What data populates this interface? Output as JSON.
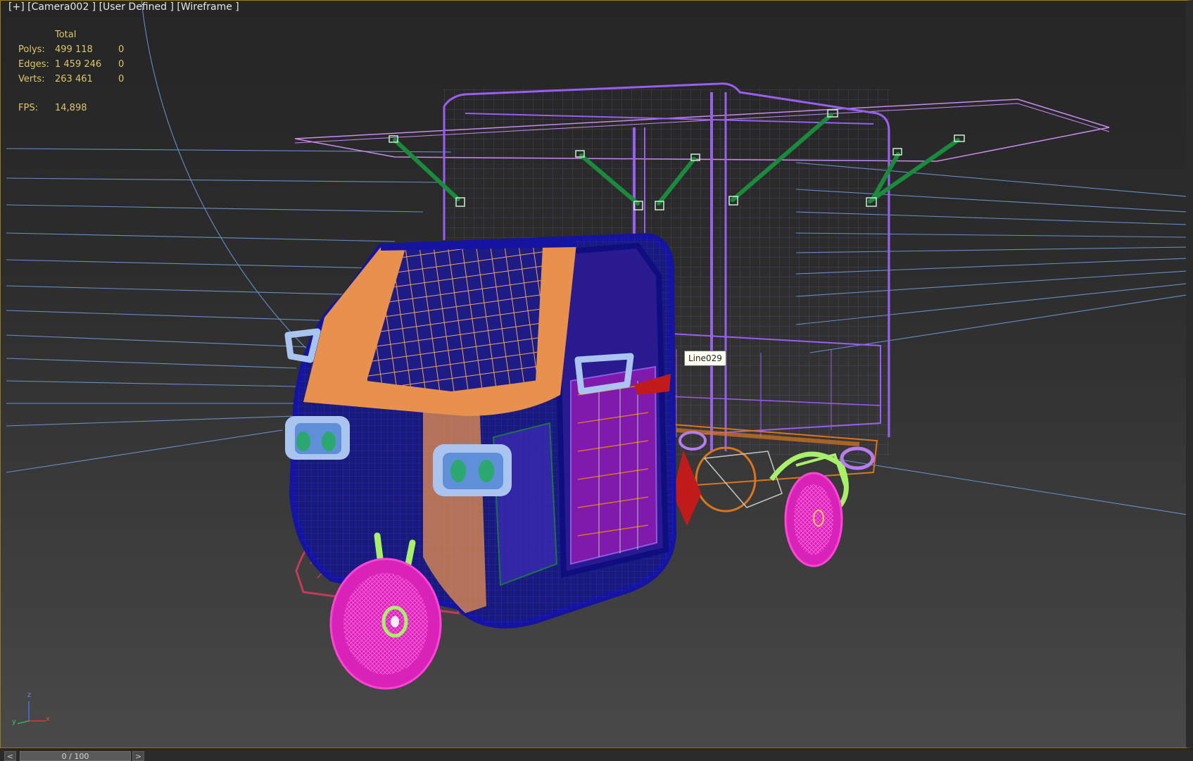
{
  "viewport": {
    "label": "[+] [Camera002 ] [User Defined ] [Wireframe ]",
    "background_top": "#252525",
    "background_bottom": "#494949",
    "border_color": "#9c7a1e"
  },
  "stats": {
    "column_header": "Total",
    "rows": [
      {
        "label": "Polys:",
        "total": "499 118",
        "selected": "0"
      },
      {
        "label": "Edges:",
        "total": "1 459 246",
        "selected": "0"
      },
      {
        "label": "Verts:",
        "total": "263 461",
        "selected": "0"
      }
    ],
    "fps_label": "FPS:",
    "fps_value": "14,898",
    "text_color": "#dcc76b"
  },
  "tooltip": {
    "text": "Line029"
  },
  "axis_gizmo": {
    "z": "z",
    "x": "x",
    "y": "y"
  },
  "timeline": {
    "prev_icon": "chevron-left-icon",
    "prev_glyph": "<",
    "next_icon": "chevron-right-icon",
    "next_glyph": ">",
    "frame_display": "0 / 100"
  },
  "wire_colors": {
    "cabin": "#1414a0",
    "hood": "#e8914f",
    "canopy": "#9a5ef0",
    "struts": "#1a8a3c",
    "wheels": "#d822b8",
    "lights": "#aac4f0",
    "chassis": "#d8761e",
    "fender": "#c23a5c",
    "suspension": "#a8f06a",
    "seat": "#c01a1a",
    "grid": "#6ea0e0"
  }
}
